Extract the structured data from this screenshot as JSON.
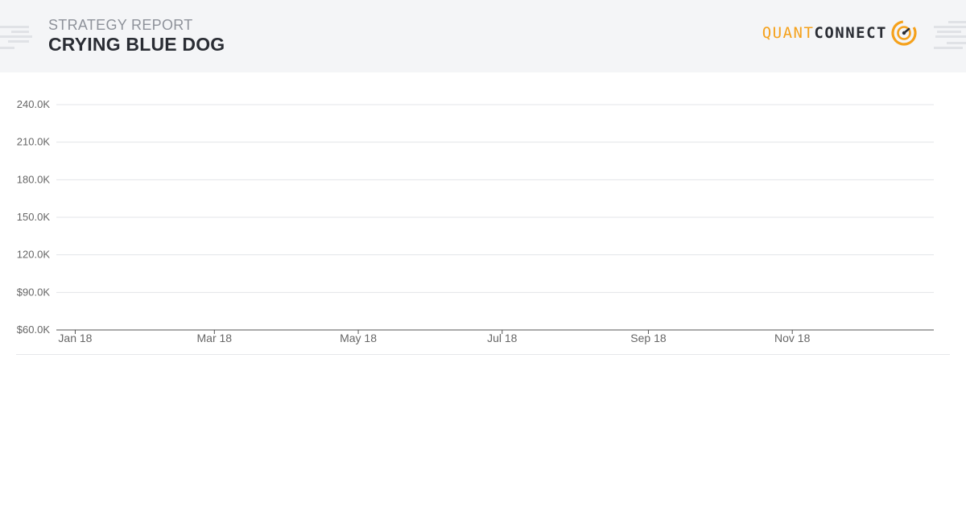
{
  "header": {
    "subtitle": "STRATEGY REPORT",
    "title": "CRYING BLUE DOG",
    "logo_text_primary": "QUANT",
    "logo_text_secondary": "CONNECT",
    "logo_icon": "quantconnect-logo-icon"
  },
  "colors": {
    "accent": "#f5a11b",
    "header_bg": "#f4f5f7",
    "title": "#2a2d34",
    "subtitle": "#8e929a",
    "gridline": "#e3e4e8",
    "axis": "#555555",
    "tick_label": "#666666"
  },
  "chart_data": {
    "type": "line",
    "title": "",
    "xlabel": "",
    "ylabel": "",
    "x_ticks": [
      "Jan 18",
      "Mar 18",
      "May 18",
      "Jul 18",
      "Sep 18",
      "Nov 18"
    ],
    "y_ticks": [
      "$60.0K",
      "$90.0K",
      "120.0K",
      "150.0K",
      "180.0K",
      "210.0K",
      "240.0K"
    ],
    "ylim": [
      60000,
      240000
    ],
    "xlim": [
      "2017-12-24",
      "2018-12-31"
    ],
    "x_tick_dates": [
      "2018-01-01",
      "2018-03-01",
      "2018-05-01",
      "2018-07-01",
      "2018-09-01",
      "2018-11-01"
    ],
    "grid": true,
    "series": []
  }
}
